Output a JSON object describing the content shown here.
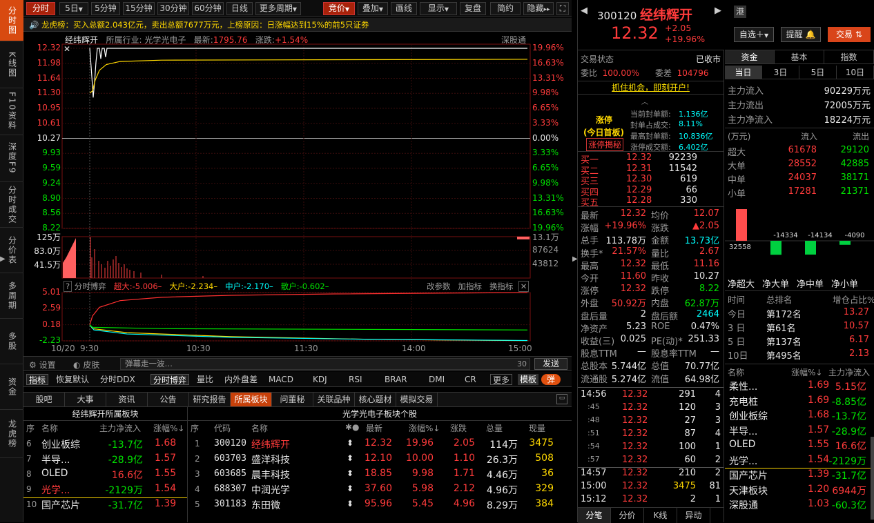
{
  "left_tabs": [
    {
      "label": "分时图",
      "active": true
    },
    {
      "label": "K线图"
    },
    {
      "label": "F10资料"
    },
    {
      "label": "深度F9"
    },
    {
      "label": "分时成交"
    },
    {
      "label": "分价表"
    },
    {
      "label": "多周期"
    },
    {
      "label": "多股"
    },
    {
      "label": "资金"
    },
    {
      "label": "龙虎榜"
    }
  ],
  "toolbar": {
    "periods": [
      "分时",
      "5日",
      "5分钟",
      "15分钟",
      "30分钟",
      "60分钟",
      "日线",
      "更多周期"
    ],
    "tools": [
      "竞价",
      "叠加",
      "画线",
      "显示",
      "复盘",
      "简约",
      "隐藏"
    ]
  },
  "ticker_text": "龙虎榜：买入总额2.043亿元，卖出总额7677万元，上榜原因：日涨幅达到15%的前5只证券",
  "chart": {
    "name": "经纬辉开",
    "industry": "所属行业: 光学光电子",
    "latest_label": "最新:",
    "latest": "1795.76",
    "change_label": "涨跌:",
    "change": "+1.54%",
    "exchange": "深股通",
    "price_ticks": [
      "12.32",
      "11.98",
      "11.64",
      "11.30",
      "10.95",
      "10.61",
      "10.27",
      "9.93",
      "9.59",
      "9.24",
      "8.90",
      "8.56",
      "8.22"
    ],
    "pct_ticks": [
      "19.96%",
      "16.63%",
      "13.31%",
      "9.98%",
      "6.65%",
      "3.33%",
      "0.00%",
      "3.33%",
      "6.65%",
      "9.98%",
      "13.31%",
      "16.63%",
      "19.96%"
    ],
    "vol_ticks_left": [
      "125万",
      "83.0万",
      "41.5万"
    ],
    "vol_ticks_right": [
      "13.1万",
      "87624",
      "43812"
    ],
    "game_title": "分时博弈",
    "game_super": "超大:-5.006–",
    "game_large": "大户:-2.234–",
    "game_mid": "中户:-2.170–",
    "game_small": "散户:-0.602–",
    "game_btns": [
      "改参数",
      "加指标",
      "换指标"
    ],
    "game_ticks": [
      "5.01",
      "2.59",
      "0.18",
      "-2.23"
    ],
    "time_ticks": [
      "10/20",
      "9:30",
      "10:30",
      "11:30",
      "14:00",
      "15:00"
    ]
  },
  "chart_data": [
    {
      "type": "line",
      "title": "",
      "series": [
        {
          "name": "price",
          "x": [
            "9:30",
            "9:31",
            "9:32",
            "9:33",
            "9:35",
            "9:37",
            "9:38",
            "9:40",
            "9:42",
            "9:45",
            "10:00",
            "10:30",
            "11:30",
            "14:00",
            "15:00"
          ],
          "values": [
            12.32,
            11.4,
            11.16,
            11.9,
            12.32,
            12.1,
            12.32,
            12.05,
            12.32,
            12.32,
            12.32,
            12.32,
            12.32,
            12.32,
            12.32
          ]
        },
        {
          "name": "avg",
          "x": [
            "9:30",
            "9:32",
            "9:40",
            "10:00",
            "10:30",
            "15:00"
          ],
          "values": [
            11.3,
            11.4,
            11.9,
            12.02,
            12.05,
            12.07
          ]
        }
      ],
      "ylim": [
        8.22,
        12.32
      ]
    },
    {
      "type": "line",
      "title": "分时博弈",
      "series": [
        {
          "name": "超大",
          "values": [
            0.3,
            3.8,
            4.6,
            5.0,
            5.01
          ]
        },
        {
          "name": "大户",
          "values": [
            0.0,
            -1.2,
            -1.9,
            -2.2,
            -2.234
          ]
        },
        {
          "name": "中户",
          "values": [
            0.0,
            -1.0,
            -1.6,
            -2.0,
            -2.17
          ]
        },
        {
          "name": "散户",
          "values": [
            0.0,
            -0.3,
            -0.5,
            -0.6,
            -0.602
          ]
        }
      ],
      "x": [
        "9:30",
        "10:30",
        "11:30",
        "14:00",
        "15:00"
      ]
    }
  ],
  "chat": {
    "settings": "设置",
    "skin": "皮肤",
    "placeholder": "弹幕走一波…",
    "count": "30",
    "send": "发送"
  },
  "indicators": [
    "指标",
    "恢复默认",
    "分时DDX",
    "分时博弈",
    "量比",
    "内外盘差",
    "MACD",
    "KDJ",
    "RSI",
    "BRAR",
    "DMI",
    "CR",
    "更多",
    "模板",
    "弹"
  ],
  "info_tabs": [
    "股吧",
    "大事",
    "资讯",
    "公告",
    "研究报告",
    "所属板块",
    "问董秘",
    "关联品种",
    "核心题材",
    "模拟交易"
  ],
  "sector_title": "经纬辉开所属板块",
  "board_title": "光学光电子板块个股",
  "sector_headers": [
    "序",
    "名称",
    "主力净流入",
    "涨幅%"
  ],
  "sectors": [
    [
      "6",
      "创业板综",
      "-13.7亿",
      "1.68"
    ],
    [
      "7",
      "半导...",
      "-28.9亿",
      "1.57"
    ],
    [
      "8",
      "OLED",
      "16.6亿",
      "1.55"
    ],
    [
      "9",
      "光学...",
      "-2129万",
      "1.54"
    ],
    [
      "10",
      "国产芯片",
      "-31.7亿",
      "1.39"
    ]
  ],
  "stock_headers": [
    "序",
    "代码",
    "名称",
    "",
    "最新",
    "涨幅%",
    "涨跌",
    "总量",
    "现量"
  ],
  "stocks": [
    [
      "1",
      "300120",
      "经纬辉开",
      "12.32",
      "19.96",
      "2.05",
      "114万",
      "3475"
    ],
    [
      "2",
      "603703",
      "盛洋科技",
      "12.10",
      "10.00",
      "1.10",
      "26.3万",
      "508"
    ],
    [
      "3",
      "603685",
      "晨丰科技",
      "18.85",
      "9.98",
      "1.71",
      "4.46万",
      "36"
    ],
    [
      "4",
      "688307",
      "中润光学",
      "37.60",
      "5.98",
      "2.12",
      "4.96万",
      "329"
    ],
    [
      "5",
      "301183",
      "东田微",
      "95.96",
      "5.45",
      "4.96",
      "8.29万",
      "384"
    ]
  ],
  "quote": {
    "code": "300120",
    "name": "经纬辉开",
    "hk": "港",
    "price": "12.32",
    "chg": "+2.05",
    "pct": "+19.96%",
    "btn_fav": "自选",
    "btn_alert": "提醒",
    "btn_trade": "交易"
  },
  "status": {
    "label": "交易状态",
    "value": "已收市",
    "wb_label": "委比",
    "wb": "100.00%",
    "wc_label": "委差",
    "wc": "104796",
    "promo": "抓住机会，即刻开户!"
  },
  "limitup": {
    "title": "涨停",
    "sub": "(今日首板)",
    "btn": "涨停揭秘",
    "items": [
      [
        "当前封单额:",
        "1.136亿"
      ],
      [
        "封单占成交:",
        "8.11%"
      ],
      [
        "最高封单额:",
        "10.836亿"
      ],
      [
        "涨停成交额:",
        "6.402亿"
      ]
    ]
  },
  "bids": [
    [
      "买一",
      "12.32",
      "92239"
    ],
    [
      "买二",
      "12.31",
      "11542"
    ],
    [
      "买三",
      "12.30",
      "619"
    ],
    [
      "买四",
      "12.29",
      "66"
    ],
    [
      "买五",
      "12.28",
      "330"
    ]
  ],
  "stats": [
    [
      "最新",
      "12.32",
      "均价",
      "12.07"
    ],
    [
      "涨幅",
      "+19.96%",
      "涨跌",
      "▲2.05"
    ],
    [
      "总手",
      "113.78万",
      "金额",
      "13.73亿"
    ],
    [
      "换手*",
      "21.57%",
      "量比",
      "2.67"
    ],
    [
      "最高",
      "12.32",
      "最低",
      "11.16"
    ],
    [
      "今开",
      "11.60",
      "昨收",
      "10.27"
    ],
    [
      "涨停",
      "12.32",
      "跌停",
      "8.22"
    ],
    [
      "外盘",
      "50.92万",
      "内盘",
      "62.87万"
    ],
    [
      "盘后量",
      "2",
      "盘后额",
      "2464"
    ],
    [
      "净资产",
      "5.23",
      "ROE",
      "0.47%"
    ],
    [
      "收益(三)",
      "0.025",
      "PE(动)*",
      "251.33"
    ],
    [
      "股息TTM",
      "—",
      "股息率TTM",
      "—"
    ],
    [
      "总股本",
      "5.744亿",
      "总值",
      "70.77亿"
    ],
    [
      "流通股",
      "5.274亿",
      "流值",
      "64.98亿"
    ]
  ],
  "ticks": [
    [
      "14:56",
      "12.32",
      "291",
      "4"
    ],
    [
      ":45",
      "12.32",
      "120",
      "3"
    ],
    [
      ":48",
      "12.32",
      "27",
      "3"
    ],
    [
      ":51",
      "12.32",
      "87",
      "4"
    ],
    [
      ":54",
      "12.32",
      "100",
      "1"
    ],
    [
      ":57",
      "12.32",
      "60",
      "2"
    ],
    [
      "14:57",
      "12.32",
      "210",
      "2"
    ],
    [
      "15:00",
      "12.32",
      "3475",
      "81"
    ],
    [
      "15:12",
      "12.32",
      "2",
      "1"
    ]
  ],
  "tick_tabs": [
    "分笔",
    "分价",
    "K线",
    "异动"
  ],
  "fund": {
    "tabs": [
      "资金",
      "基本",
      "指数"
    ],
    "periods": [
      "当日",
      "3日",
      "5日",
      "10日"
    ],
    "flows": [
      [
        "主力流入",
        "90229万元"
      ],
      [
        "主力流出",
        "72005万元"
      ],
      [
        "主力净流入",
        "18224万元"
      ]
    ],
    "head": [
      "(万元)",
      "流入",
      "流出"
    ],
    "rows": [
      [
        "超大",
        "61678",
        "29120"
      ],
      [
        "大单",
        "28552",
        "42885"
      ],
      [
        "中单",
        "24037",
        "38171"
      ],
      [
        "小单",
        "17281",
        "21371"
      ]
    ],
    "bars": [
      {
        "label": "净超大",
        "value": 32558
      },
      {
        "label": "净大单",
        "value": -14334
      },
      {
        "label": "净中单",
        "value": -14134
      },
      {
        "label": "净小单",
        "value": -4090
      }
    ],
    "rank_head": [
      "时间",
      "总排名",
      "增仓占比%"
    ],
    "ranks": [
      [
        "今日",
        "第172名",
        "13.27"
      ],
      [
        "3 日",
        "第61名",
        "10.57"
      ],
      [
        "5 日",
        "第137名",
        "6.17"
      ],
      [
        "10日",
        "第495名",
        "2.13"
      ]
    ],
    "sec_head": [
      "名称",
      "涨幅%↓",
      "主力净流入"
    ],
    "secs": [
      [
        "柔性...",
        "1.69",
        "5.15亿"
      ],
      [
        "充电桩",
        "1.69",
        "-8.85亿"
      ],
      [
        "创业板综",
        "1.68",
        "-13.7亿"
      ],
      [
        "半导...",
        "1.57",
        "-28.9亿"
      ],
      [
        "OLED",
        "1.55",
        "16.6亿"
      ],
      [
        "光学...",
        "1.54",
        "-2129万"
      ],
      [
        "国产芯片",
        "1.39",
        "-31.7亿"
      ],
      [
        "天津板块",
        "1.20",
        "6944万"
      ],
      [
        "深股通",
        "1.03",
        "-60.3亿"
      ]
    ]
  }
}
